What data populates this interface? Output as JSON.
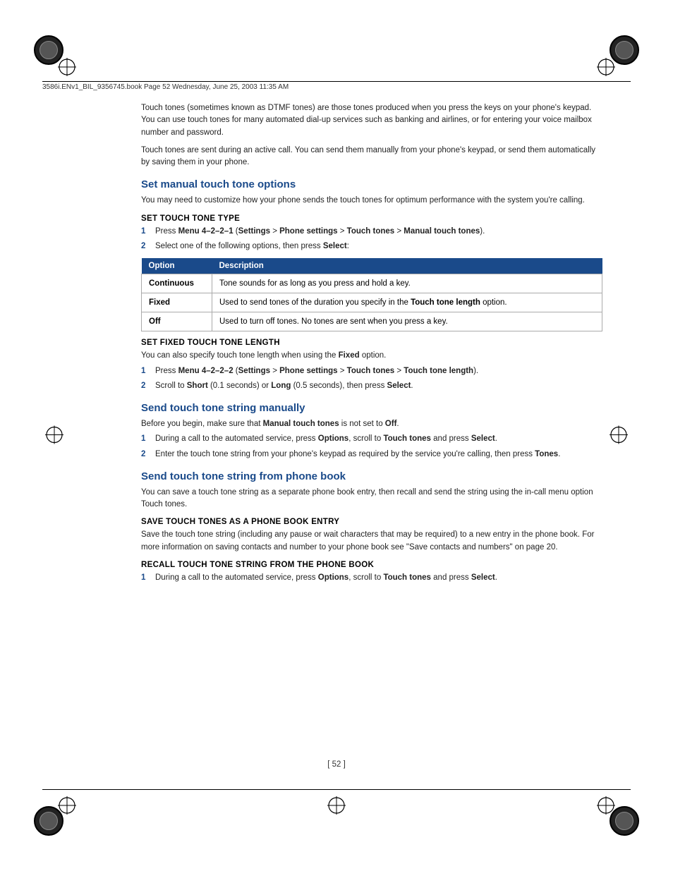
{
  "page": {
    "dimensions": "954x1235",
    "background": "#ffffff"
  },
  "header": {
    "file_info": "3586i.ENv1_BIL_9356745.book  Page 52  Wednesday, June 25, 2003  11:35 AM"
  },
  "intro": {
    "paragraph1": "Touch tones (sometimes known as DTMF tones) are those tones produced when you press the keys on your phone's keypad. You can use touch tones for many automated dial-up services such as banking and airlines, or for entering your voice mailbox number and password.",
    "paragraph2": "Touch tones are sent during an active call. You can send them manually from your phone's keypad, or send them automatically by saving them in your phone."
  },
  "sections": [
    {
      "id": "set-manual",
      "heading": "Set manual touch tone options",
      "intro": "You may need to customize how your phone sends the touch tones for optimum performance with the system you're calling.",
      "sub_sections": [
        {
          "id": "set-touch-tone-type",
          "sub_heading": "SET TOUCH TONE TYPE",
          "steps": [
            {
              "num": "1",
              "text": "Press Menu 4–2–2–1 (Settings > Phone settings > Touch tones > Manual touch tones)."
            },
            {
              "num": "2",
              "text": "Select one of the following options, then press Select:"
            }
          ],
          "table": {
            "headers": [
              "Option",
              "Description"
            ],
            "rows": [
              {
                "option": "Continuous",
                "description": "Tone sounds for as long as you press and hold a key."
              },
              {
                "option": "Fixed",
                "description": "Used to send tones of the duration you specify in the Touch tone length option."
              },
              {
                "option": "Off",
                "description": "Used to turn off tones. No tones are sent when you press a key."
              }
            ]
          }
        },
        {
          "id": "set-fixed-touch-tone-length",
          "sub_heading": "SET FIXED TOUCH TONE LENGTH",
          "intro": "You can also specify touch tone length when using the Fixed option.",
          "steps": [
            {
              "num": "1",
              "text": "Press Menu 4–2–2–2 (Settings > Phone settings > Touch tones > Touch tone length)."
            },
            {
              "num": "2",
              "text": "Scroll to Short (0.1 seconds) or Long (0.5 seconds), then press Select."
            }
          ]
        }
      ]
    },
    {
      "id": "send-manually",
      "heading": "Send touch tone string manually",
      "intro": "Before you begin, make sure that Manual touch tones is not set to Off.",
      "steps": [
        {
          "num": "1",
          "text": "During a call to the automated service, press Options, scroll to Touch tones and press Select."
        },
        {
          "num": "2",
          "text": "Enter the touch tone string from your phone's keypad as required by the service you're calling, then press Tones."
        }
      ]
    },
    {
      "id": "send-from-phone-book",
      "heading": "Send touch tone string from phone book",
      "intro": "You can save a touch tone string as a separate phone book entry, then recall and send the string using the in-call menu option Touch tones.",
      "sub_sections": [
        {
          "id": "save-touch-tones",
          "sub_heading": "SAVE TOUCH TONES AS A PHONE BOOK ENTRY",
          "text": "Save the touch tone string (including any pause or wait characters that may be required) to a new entry in the phone book. For more information on saving contacts and number to your phone book see \"Save contacts and numbers\" on page 20."
        },
        {
          "id": "recall-touch-tone",
          "sub_heading": "RECALL TOUCH TONE STRING FROM THE PHONE BOOK",
          "steps": [
            {
              "num": "1",
              "text": "During a call to the automated service, press Options, scroll to Touch tones and press Select."
            }
          ]
        }
      ]
    }
  ],
  "page_number": "[ 52 ]"
}
